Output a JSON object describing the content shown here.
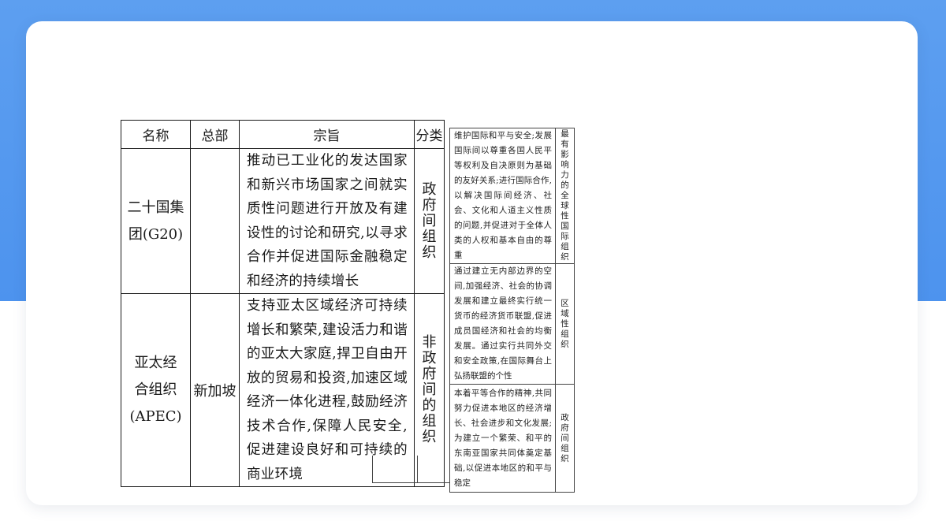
{
  "headers": {
    "name": "名称",
    "hq": "总部",
    "aim": "宗旨",
    "category": "分类"
  },
  "rows": [
    {
      "name_line1": "二十国集",
      "name_line2": "团(G20)",
      "hq": "",
      "aim": "推动已工业化的发达国家和新兴市场国家之间就实质性问题进行开放及有建设性的讨论和研究,以寻求合作并促进国际金融稳定和经济的持续增长",
      "category": "政府间组织"
    },
    {
      "name_line1": "亚太经",
      "name_line2": "合组织",
      "name_line3": "(APEC)",
      "hq": "新加坡",
      "aim": "支持亚太区域经济可持续增长和繁荣,建设活力和谐的亚太大家庭,捍卫自由开放的贸易和投资,加速区域经济一体化进程,鼓励经济技术合作,保障人民安全,促进建设良好和可持续的商业环境",
      "category": "非政府间的组织"
    }
  ],
  "side_rows": [
    {
      "aim": "维护国际和平与安全;发展国际间以尊重各国人民平等权利及自决原则为基础的友好关系;进行国际合作,以解决国际间经济、社会、文化和人道主义性质的问题,并促进对于全体人类的人权和基本自由的尊重",
      "category": "最有影响力的全球性国际组织"
    },
    {
      "aim": "通过建立无内部边界的空间,加强经济、社会的协调发展和建立最终实行统一货币的经济货币联盟,促进成员国经济和社会的均衡发展。通过实行共同外交和安全政策,在国际舞台上弘扬联盟的个性",
      "category": "区域性组织"
    },
    {
      "aim": "本着平等合作的精神,共同努力促进本地区的经济增长、社会进步和文化发展;为建立一个繁荣、和平的东南亚国家共同体奠定基础,以促进本地区的和平与稳定",
      "category": "政府间组织"
    }
  ]
}
